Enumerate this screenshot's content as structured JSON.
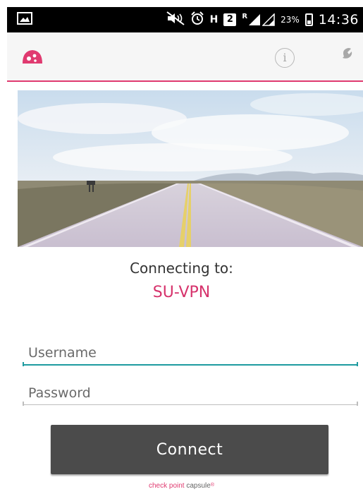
{
  "status_bar": {
    "signal_label": "R",
    "sim_slot": "2",
    "network_label": "H",
    "battery_percent": "23%",
    "time": "14:36",
    "icons": [
      "image-notification-icon",
      "mute-icon",
      "alarm-icon",
      "network-h-icon",
      "sim-2-icon",
      "signal-icon",
      "battery-icon"
    ]
  },
  "app_bar": {
    "logo_icon": "check-point-capsule-logo",
    "info_label": "i",
    "settings_icon": "wrench-icon",
    "accent_color": "#e03a70"
  },
  "connection": {
    "label": "Connecting to:",
    "server": "SU-VPN",
    "server_color": "#d6336c"
  },
  "form": {
    "username_placeholder": "Username",
    "password_placeholder": "Password",
    "username_value": "",
    "password_value": "",
    "connect_label": "Connect"
  },
  "footer": {
    "brand_first": "check point",
    "brand_second": "capsule",
    "brand_mark": "®"
  }
}
